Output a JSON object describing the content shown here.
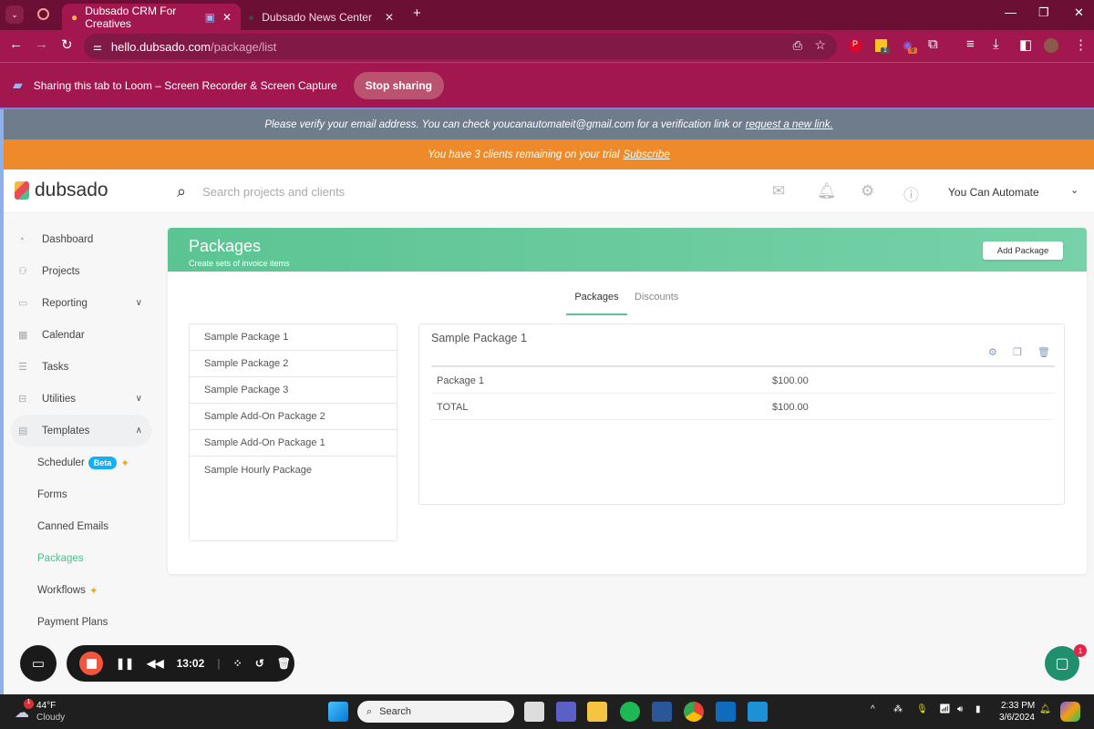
{
  "browser": {
    "tabs": [
      {
        "title": "Dubsado CRM For Creatives"
      },
      {
        "title": "Dubsado News Center"
      }
    ],
    "url_host": "hello.dubsado.com",
    "url_path": "/package/list"
  },
  "sharing": {
    "text": "Sharing this tab to Loom – Screen Recorder & Screen Capture",
    "stop_label": "Stop sharing"
  },
  "extensions": {
    "badge1": "1",
    "badge2": "9"
  },
  "verify": {
    "text": "Please verify your email address. You can check youcanautomateit@gmail.com for a verification link or",
    "link": "request a new link."
  },
  "trial": {
    "text": "You have 3 clients remaining on your trial",
    "link": "Subscribe"
  },
  "header": {
    "logo": "dubsado",
    "search_placeholder": "Search projects and clients",
    "user": "You Can Automate"
  },
  "sidebar": {
    "items": [
      {
        "label": "Dashboard"
      },
      {
        "label": "Projects"
      },
      {
        "label": "Reporting"
      },
      {
        "label": "Calendar"
      },
      {
        "label": "Tasks"
      },
      {
        "label": "Utilities"
      },
      {
        "label": "Templates"
      }
    ],
    "sub": [
      {
        "label": "Scheduler",
        "badge": "Beta"
      },
      {
        "label": "Forms"
      },
      {
        "label": "Canned Emails"
      },
      {
        "label": "Packages"
      },
      {
        "label": "Workflows"
      },
      {
        "label": "Payment Plans"
      }
    ]
  },
  "page": {
    "title": "Packages",
    "subtitle": "Create sets of invoice items",
    "add_label": "Add Package",
    "tabs": [
      "Packages",
      "Discounts"
    ],
    "packages": [
      "Sample Package 1",
      "Sample Package 2",
      "Sample Package 3",
      "Sample Add-On Package 2",
      "Sample Add-On Package 1",
      "Sample Hourly Package"
    ],
    "detail": {
      "title": "Sample Package 1",
      "rows": [
        {
          "name": "Package 1",
          "amount": "$100.00"
        },
        {
          "name": "TOTAL",
          "amount": "$100.00"
        }
      ]
    }
  },
  "loom": {
    "time": "13:02"
  },
  "chat": {
    "badge": "1"
  },
  "taskbar": {
    "weather_temp": "44°F",
    "weather_desc": "Cloudy",
    "weather_badge": "1",
    "search": "Search",
    "time": "2:33 PM",
    "date": "3/6/2024"
  }
}
